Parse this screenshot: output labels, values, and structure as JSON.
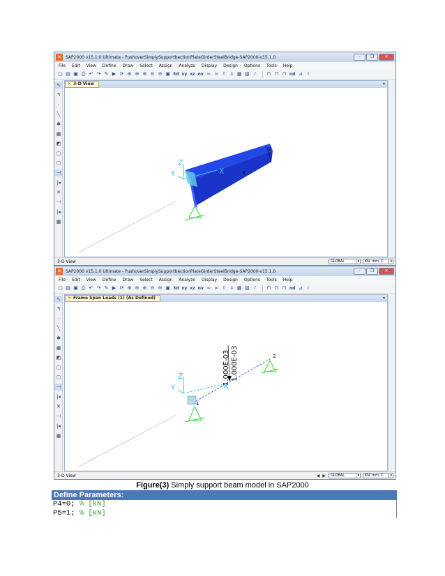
{
  "window1": {
    "title": "SAP2000 v15.1.0 Ultimate - PushoverSimplySupportbectionPlateGirderSteelBridge-SAP2000-v15.1.0",
    "menu": [
      "File",
      "Edit",
      "View",
      "Define",
      "Draw",
      "Select",
      "Assign",
      "Analyze",
      "Display",
      "Design",
      "Options",
      "Tools",
      "Help"
    ],
    "view_tab": "3-D View",
    "node_label": "3",
    "node2_label": "2",
    "axis_x": "X",
    "axis_y": "Y",
    "axis_z": "Z",
    "status_text": "3-D View",
    "coord_system": "GLOBAL",
    "units": "KN, mm, C"
  },
  "window2": {
    "title": "SAP2000 v15.1.0 Ultimate - PushoverSimplySupportbectionPlateGirderSteelBridge-SAP2000-v15.1.0",
    "menu": [
      "File",
      "Edit",
      "View",
      "Define",
      "Draw",
      "Select",
      "Assign",
      "Analyze",
      "Display",
      "Design",
      "Options",
      "Tools",
      "Help"
    ],
    "view_tab": "Frame Span Loads (1) (As Defined)",
    "load_label_1": "1.000E-03",
    "load_label_2": "1.000E-03",
    "node1_label": "1",
    "node2_label": "2",
    "axis_x": "X",
    "axis_y": "Y",
    "axis_z": "Z",
    "status_text": "3-D View",
    "coord_system": "GLOBAL",
    "units": "KN, mm, C"
  },
  "toolbar": {
    "xy": "xy",
    "xz": "xz",
    "yz": "nv",
    "nd": "nd"
  },
  "colors": {
    "beam": "#1f3fe0",
    "axis": "#33c3e0",
    "support": "#36d43a",
    "section_header": "#4a78b8",
    "comment": "#3c9a3c"
  },
  "caption": {
    "label": "Figure(3)",
    "text": " Simply support beam model in SAP2000"
  },
  "params": {
    "header": "Define Parameters:",
    "lines": [
      {
        "code": "P4=0; ",
        "comment": "% [kN]"
      },
      {
        "code": "P5=1; ",
        "comment": "% [kN]"
      }
    ]
  }
}
